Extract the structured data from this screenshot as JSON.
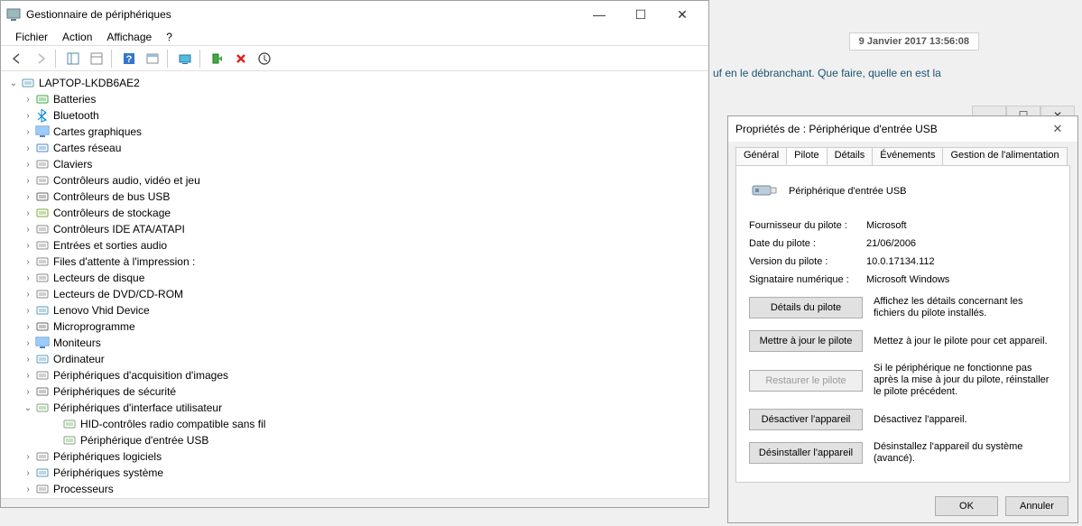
{
  "dm": {
    "title": "Gestionnaire de périphériques",
    "menus": [
      "Fichier",
      "Action",
      "Affichage",
      "?"
    ],
    "root": "LAPTOP-LKDB6AE2",
    "nodes": [
      {
        "label": "Batteries",
        "icon": "battery"
      },
      {
        "label": "Bluetooth",
        "icon": "bluetooth"
      },
      {
        "label": "Cartes graphiques",
        "icon": "display"
      },
      {
        "label": "Cartes réseau",
        "icon": "network"
      },
      {
        "label": "Claviers",
        "icon": "keyboard"
      },
      {
        "label": "Contrôleurs audio, vidéo et jeu",
        "icon": "audio"
      },
      {
        "label": "Contrôleurs de bus USB",
        "icon": "usb"
      },
      {
        "label": "Contrôleurs de stockage",
        "icon": "storage"
      },
      {
        "label": "Contrôleurs IDE ATA/ATAPI",
        "icon": "ide"
      },
      {
        "label": "Entrées et sorties audio",
        "icon": "audioio"
      },
      {
        "label": "Files d'attente à l'impression :",
        "icon": "printer"
      },
      {
        "label": "Lecteurs de disque",
        "icon": "disk"
      },
      {
        "label": "Lecteurs de DVD/CD-ROM",
        "icon": "dvd"
      },
      {
        "label": "Lenovo Vhid Device",
        "icon": "device"
      },
      {
        "label": "Microprogramme",
        "icon": "firmware"
      },
      {
        "label": "Moniteurs",
        "icon": "monitor"
      },
      {
        "label": "Ordinateur",
        "icon": "computer"
      },
      {
        "label": "Périphériques d'acquisition d'images",
        "icon": "camera"
      },
      {
        "label": "Périphériques de sécurité",
        "icon": "security"
      },
      {
        "label": "Périphériques d'interface utilisateur",
        "icon": "hid",
        "expanded": true,
        "children": [
          {
            "label": "HID-contrôles radio compatible sans fil",
            "icon": "hidchild"
          },
          {
            "label": "Périphérique d'entrée USB",
            "icon": "hidchild"
          }
        ]
      },
      {
        "label": "Périphériques logiciels",
        "icon": "software"
      },
      {
        "label": "Périphériques système",
        "icon": "system"
      },
      {
        "label": "Processeurs",
        "icon": "cpu"
      }
    ]
  },
  "forum": {
    "date": "9 Janvier 2017 13:56:08",
    "line": "uf en le débranchant. Que faire, quelle en est la",
    "la": "la"
  },
  "prop": {
    "title": "Propriétés de : Périphérique d'entrée USB",
    "tabs": {
      "general": "Général",
      "driver": "Pilote",
      "details": "Détails",
      "events": "Événements",
      "power": "Gestion de l'alimentation"
    },
    "device_name": "Périphérique d'entrée USB",
    "rows": {
      "provider_label": "Fournisseur du pilote :",
      "provider_value": "Microsoft",
      "date_label": "Date du pilote :",
      "date_value": "21/06/2006",
      "version_label": "Version du pilote :",
      "version_value": "10.0.17134.112",
      "signer_label": "Signataire numérique :",
      "signer_value": "Microsoft Windows"
    },
    "actions": {
      "details_btn": "Détails du pilote",
      "details_desc": "Affichez les détails concernant les fichiers du pilote installés.",
      "update_btn": "Mettre à jour le pilote",
      "update_desc": "Mettez à jour le pilote pour cet appareil.",
      "rollback_btn": "Restaurer le pilote",
      "rollback_desc": "Si le périphérique ne fonctionne pas après la mise à jour du pilote, réinstaller le pilote précédent.",
      "disable_btn": "Désactiver l'appareil",
      "disable_desc": "Désactivez l'appareil.",
      "uninstall_btn": "Désinstaller l'appareil",
      "uninstall_desc": "Désinstallez l'appareil du système (avancé)."
    },
    "ok": "OK",
    "cancel": "Annuler"
  }
}
